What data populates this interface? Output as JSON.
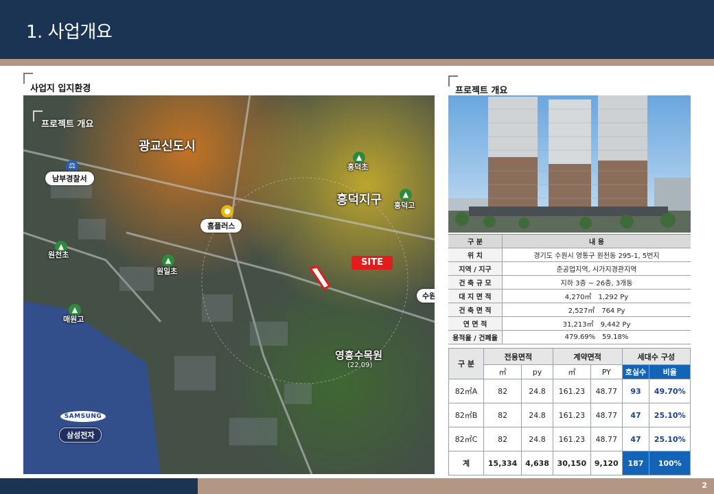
{
  "header": {
    "title": "1. 사업개요"
  },
  "left_section": {
    "heading": "사업지 입지환경"
  },
  "right_section": {
    "heading": "프로젝트 개요"
  },
  "map": {
    "inner_title": "프로젝트 개요",
    "areas": {
      "gwanggyo": "광교신도시",
      "heungdeok": "흥덕지구",
      "yeongheung_park": "영흥수목원",
      "yeongheung_park_date": "(22.09)"
    },
    "pois": {
      "police": "남부경찰서",
      "homeplus": "홈플러스",
      "samsung": "삼성전자",
      "samsung_logo": "SAMSUNG",
      "suwon_cut": "수원C",
      "heungdeok_elem": "흥덕초",
      "heungdeok_high": "흥덕고",
      "woncheon_elem": "원천초",
      "wonil_elem": "원일초",
      "maewon_high": "매원고"
    },
    "site_label": "SITE"
  },
  "overview_table": {
    "header": {
      "label": "구 분",
      "value": "내 용"
    },
    "rows": [
      {
        "label": "위 치",
        "value": "경기도 수원시 영통구 원천동 295-1, 5번지"
      },
      {
        "label": "지역 / 지구",
        "value": "준공업지역, 시가지경관지역"
      },
      {
        "label": "건 축 규 모",
        "value": "지하 3층 ~ 26층, 3개동"
      },
      {
        "label": "대 지 면 적",
        "value_a": "4,270㎡",
        "value_b": "1,292 Py"
      },
      {
        "label": "건 축 면 적",
        "value_a": "2,527㎡",
        "value_b": "764 Py"
      },
      {
        "label": "연 면 적",
        "value_a": "31,213㎡",
        "value_b": "9,442 Py"
      },
      {
        "label": "용적율 / 건폐율",
        "value_a": "479.69%",
        "value_b": "59.18%"
      }
    ]
  },
  "unit_table": {
    "headers": {
      "category": "구 분",
      "exclusive": "전용면적",
      "contract": "계약면적",
      "household": "세대수 구성"
    },
    "subheaders": [
      "㎡",
      "py",
      "㎡",
      "PY",
      "호실수",
      "비율"
    ],
    "rows": [
      {
        "type": "82㎡A",
        "ex_m2": "82",
        "ex_py": "24.8",
        "ct_m2": "161.23",
        "ct_py": "48.77",
        "units": "93",
        "ratio": "49.70%"
      },
      {
        "type": "82㎡B",
        "ex_m2": "82",
        "ex_py": "24.8",
        "ct_m2": "161.23",
        "ct_py": "48.77",
        "units": "47",
        "ratio": "25.10%"
      },
      {
        "type": "82㎡C",
        "ex_m2": "82",
        "ex_py": "24.8",
        "ct_m2": "161.23",
        "ct_py": "48.77",
        "units": "47",
        "ratio": "25.10%"
      }
    ],
    "total": {
      "type": "계",
      "ex_m2": "15,334",
      "ex_py": "4,638",
      "ct_m2": "30,150",
      "ct_py": "9,120",
      "units": "187",
      "ratio": "100%"
    }
  },
  "footer": {
    "page": "2"
  },
  "colors": {
    "navy": "#1b3454",
    "tan": "#b39784",
    "table_blue": "#1363b6",
    "site_red": "#e01d1d"
  }
}
